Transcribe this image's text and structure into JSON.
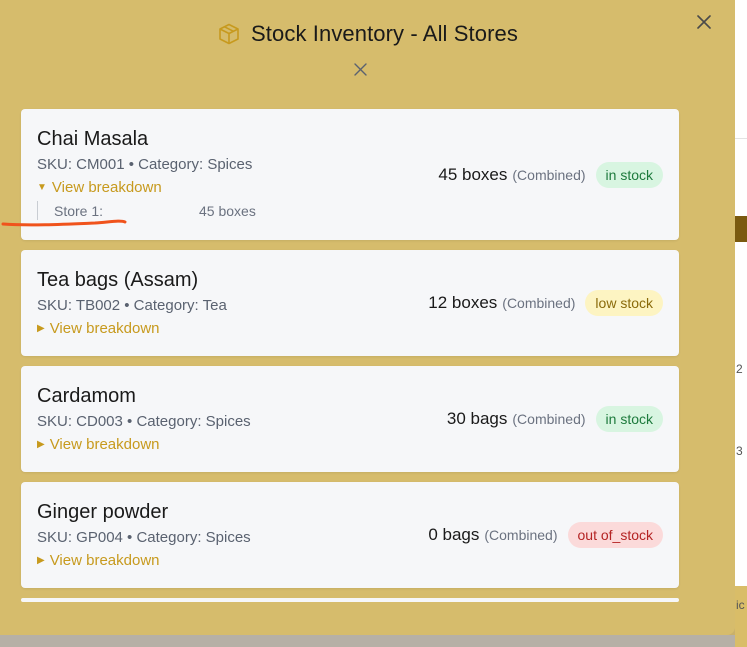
{
  "modal": {
    "title": "Stock Inventory - All Stores",
    "icon": "box-icon",
    "accent_color": "#d6bc6c"
  },
  "items": [
    {
      "name": "Chai Masala",
      "sku_line": "SKU: CM001 • Category: Spices",
      "toggle_label": "View breakdown",
      "expanded": true,
      "quantity": "45 boxes",
      "combined_label": "(Combined)",
      "status": "in stock",
      "status_kind": "in",
      "breakdown": [
        {
          "store": "Store 1:",
          "quantity": "45 boxes"
        }
      ]
    },
    {
      "name": "Tea bags (Assam)",
      "sku_line": "SKU: TB002 • Category: Tea",
      "toggle_label": "View breakdown",
      "expanded": false,
      "quantity": "12 boxes",
      "combined_label": "(Combined)",
      "status": "low stock",
      "status_kind": "low",
      "breakdown": []
    },
    {
      "name": "Cardamom",
      "sku_line": "SKU: CD003 • Category: Spices",
      "toggle_label": "View breakdown",
      "expanded": false,
      "quantity": "30 bags",
      "combined_label": "(Combined)",
      "status": "in stock",
      "status_kind": "in",
      "breakdown": []
    },
    {
      "name": "Ginger powder",
      "sku_line": "SKU: GP004 • Category: Spices",
      "toggle_label": "View breakdown",
      "expanded": false,
      "quantity": "0 bags",
      "combined_label": "(Combined)",
      "status": "out of_stock",
      "status_kind": "out",
      "breakdown": []
    }
  ],
  "background_fragments": [
    "2",
    "3",
    "ic"
  ]
}
